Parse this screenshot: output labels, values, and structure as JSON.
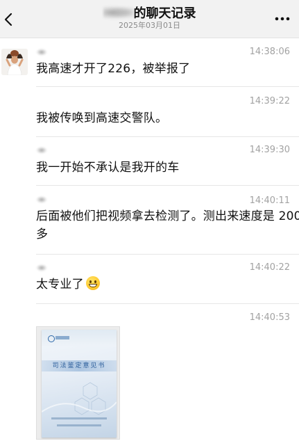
{
  "header": {
    "title_suffix": "的聊天记录",
    "date": "2025年03月01日",
    "back_icon": "chevron-left-icon",
    "more_icon": "more-dots-icon"
  },
  "messages": [
    {
      "time": "14:38:06",
      "text": "我高速才开了226，被举报了"
    },
    {
      "time": "14:39:22",
      "text": "我被传唤到高速交警队。"
    },
    {
      "time": "14:39:30",
      "text": "我一开始不承认是我开的车"
    },
    {
      "time": "14:40:11",
      "text_line1": "后面被他们把视频拿去检测了。测出来速度是 200",
      "text_line2": "多"
    },
    {
      "time": "14:40:22",
      "text": "太专业了",
      "emoji": "grinning-face-emoji"
    },
    {
      "time": "14:40:53",
      "image": {
        "title": "司法鉴定意见书"
      }
    }
  ]
}
